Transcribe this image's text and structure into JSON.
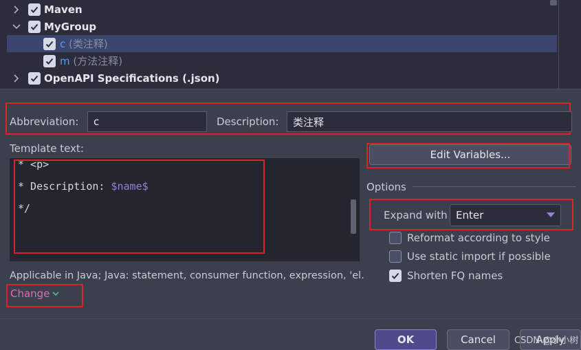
{
  "tree": {
    "items": [
      {
        "label": "Maven",
        "checked": true,
        "expanded": false
      },
      {
        "label": "MyGroup",
        "checked": true,
        "expanded": true
      },
      {
        "key": "c",
        "desc": "(类注释)",
        "checked": true,
        "selected": true
      },
      {
        "key": "m",
        "desc": "(方法注释)",
        "checked": true
      },
      {
        "label": "OpenAPI Specifications (.json)",
        "checked": true,
        "expanded": false
      }
    ]
  },
  "abbreviation": {
    "label": "Abbreviation:",
    "value": "c"
  },
  "description": {
    "label": "Description:",
    "value": "类注释"
  },
  "template": {
    "label": "Template text:",
    "lines": [
      {
        "text": "* <p>"
      },
      {
        "prefix": "* Description: ",
        "var": "$name$"
      },
      {
        "text": "*/"
      }
    ]
  },
  "edit_variables_label": "Edit Variables...",
  "options": {
    "title": "Options",
    "expand_with_label": "Expand with",
    "expand_with_value": "Enter",
    "checkboxes": [
      {
        "label": "Reformat according to style",
        "checked": false
      },
      {
        "label": "Use static import if possible",
        "checked": false
      },
      {
        "label": "Shorten FQ names",
        "checked": true
      }
    ]
  },
  "applicable_text": "Applicable in Java; Java: statement, consumer function, expression, 'el.",
  "change_label": "Change",
  "footer": {
    "ok_label": "OK",
    "cancel_label": "Cancel",
    "apply_label": "Apply"
  },
  "watermark": "CSDN @小小树",
  "colors": {
    "accent": "#4f4a8c",
    "highlight": "#e0202a",
    "link": "#e46bb4"
  }
}
